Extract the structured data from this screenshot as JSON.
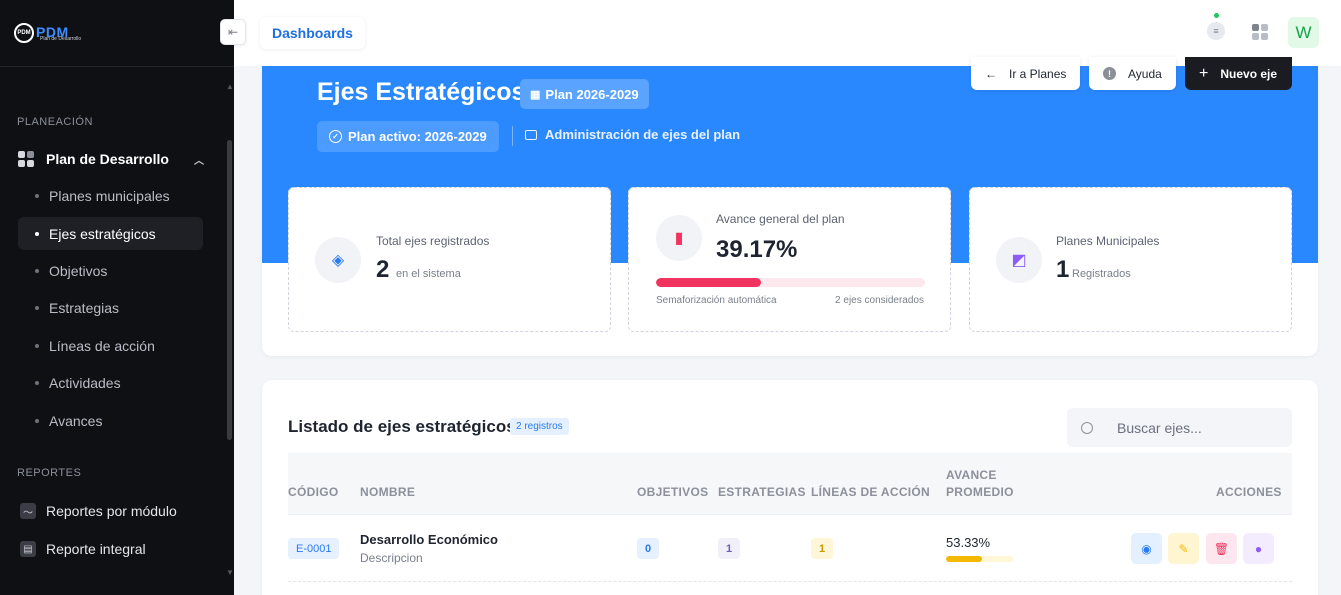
{
  "sidebar": {
    "logo_text": "PDM",
    "logo_sub": "Plan de Desarrollo",
    "logo_mark": "PDM",
    "section_planeacion": "PLANEACIÓN",
    "parent_item": "Plan de Desarrollo",
    "items": [
      {
        "label": "Planes municipales"
      },
      {
        "label": "Ejes estratégicos"
      },
      {
        "label": "Objetivos"
      },
      {
        "label": "Estrategias"
      },
      {
        "label": "Líneas de acción"
      },
      {
        "label": "Actividades"
      },
      {
        "label": "Avances"
      }
    ],
    "active_item": "Ejes estratégicos",
    "section_reportes": "REPORTES",
    "reports": [
      {
        "label": "Reportes por módulo",
        "icon": "chart-line-icon"
      },
      {
        "label": "Reporte integral",
        "icon": "document-icon"
      }
    ]
  },
  "topbar": {
    "breadcrumb": "Dashboards",
    "avatar_letter": "W",
    "status_color": "#22c55e"
  },
  "hero": {
    "title": "Ejes Estratégicos",
    "plan_badge": "Plan 2026-2029",
    "active_badge": "Plan activo: 2026-2029",
    "admin_text": "Administración de ejes del plan",
    "btn_planes": "Ir a Planes",
    "btn_ayuda": "Ayuda",
    "btn_nuevo": "Nuevo eje",
    "background": "#2a88ff"
  },
  "stats": {
    "total": {
      "label": "Total ejes registrados",
      "value": "2",
      "sub": "en el sistema"
    },
    "avance": {
      "label": "Avance general del plan",
      "value": "39.17%",
      "progress": 0.3917,
      "foot_left": "Semaforización automática",
      "foot_right": "2 ejes considerados"
    },
    "planes": {
      "label": "Planes Municipales",
      "value": "1",
      "sub": "Registrados"
    }
  },
  "list": {
    "title": "Listado de ejes estratégicos",
    "count_badge": "2 registros",
    "search_placeholder": "Buscar ejes...",
    "columns": [
      "CÓDIGO",
      "NOMBRE",
      "OBJETIVOS",
      "ESTRATEGIAS",
      "LÍNEAS DE ACCIÓN",
      "AVANCE PROMEDIO",
      "ACCIONES"
    ],
    "rows": [
      {
        "code": "E-0001",
        "name": "Desarrollo Económico",
        "description": "Descripcion",
        "objetivos": "0",
        "estrategias": "1",
        "lineas": "1",
        "avance": "53.33%",
        "avance_value": 0.5333
      }
    ]
  }
}
